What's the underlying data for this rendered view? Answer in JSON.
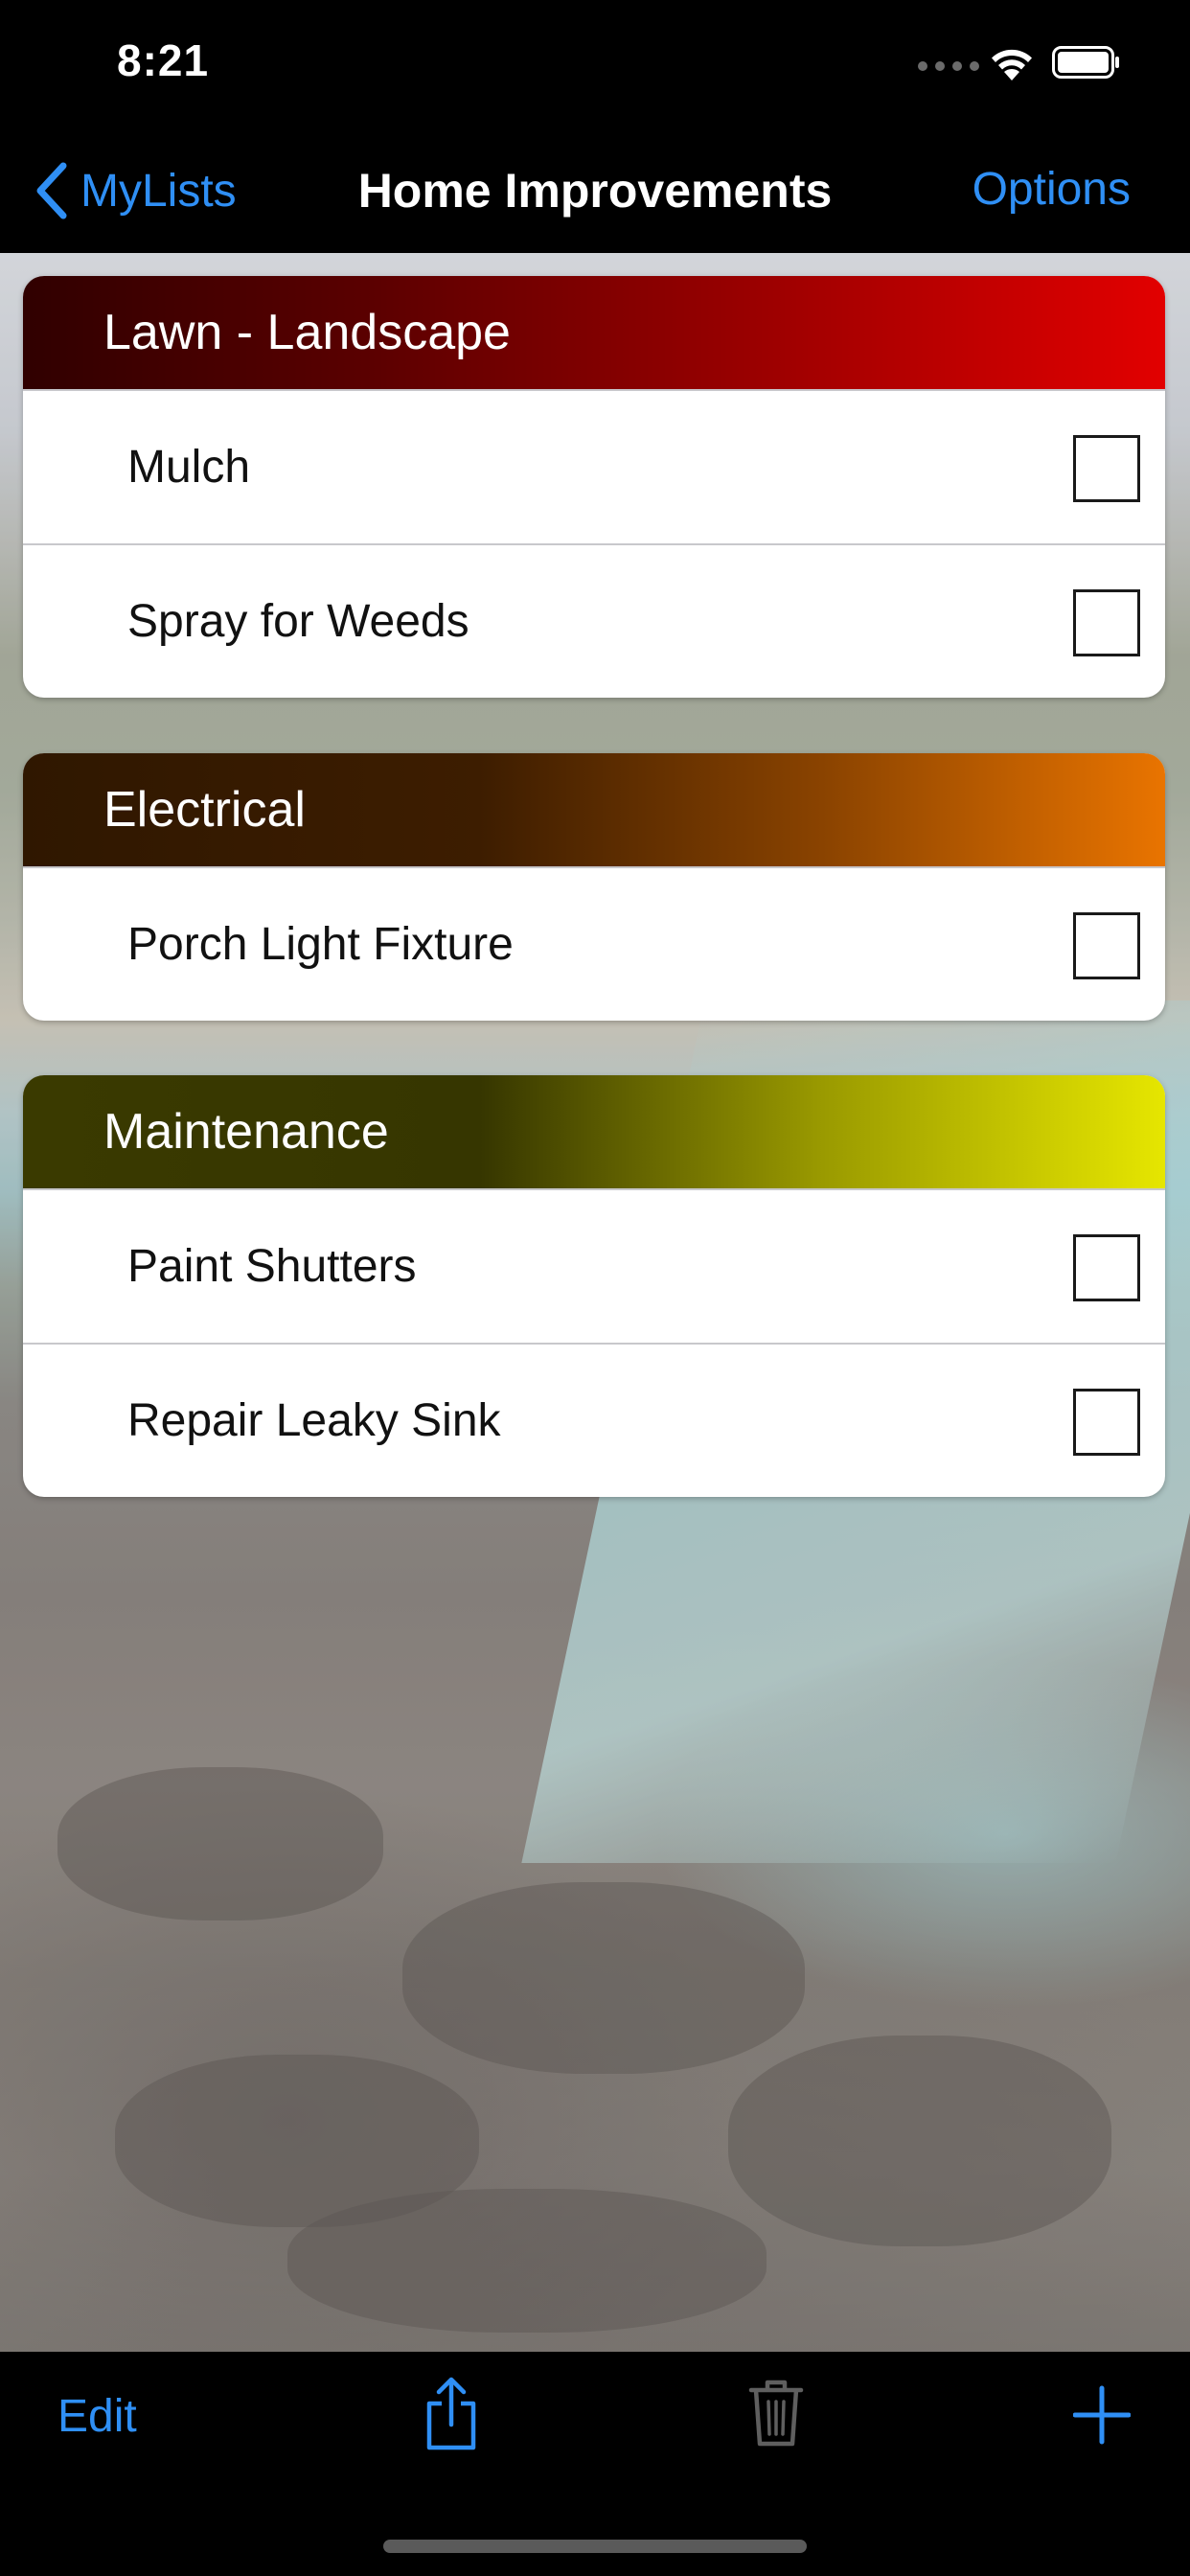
{
  "status_bar": {
    "time": "8:21"
  },
  "nav": {
    "back_label": "MyLists",
    "title": "Home Improvements",
    "options_label": "Options"
  },
  "sections": [
    {
      "title": "Lawn - Landscape",
      "color": "#e20000",
      "items": [
        {
          "label": "Mulch",
          "checked": false
        },
        {
          "label": "Spray for Weeds",
          "checked": false
        }
      ]
    },
    {
      "title": "Electrical",
      "color": "#e97400",
      "items": [
        {
          "label": "Porch Light Fixture",
          "checked": false
        }
      ]
    },
    {
      "title": "Maintenance",
      "color": "#e6e600",
      "items": [
        {
          "label": "Paint Shutters",
          "checked": false
        },
        {
          "label": "Repair Leaky Sink",
          "checked": false
        }
      ]
    }
  ],
  "toolbar": {
    "edit_label": "Edit",
    "icons": [
      "share-icon",
      "trash-icon",
      "plus-icon"
    ]
  },
  "colors": {
    "accent": "#2f8ff5"
  }
}
